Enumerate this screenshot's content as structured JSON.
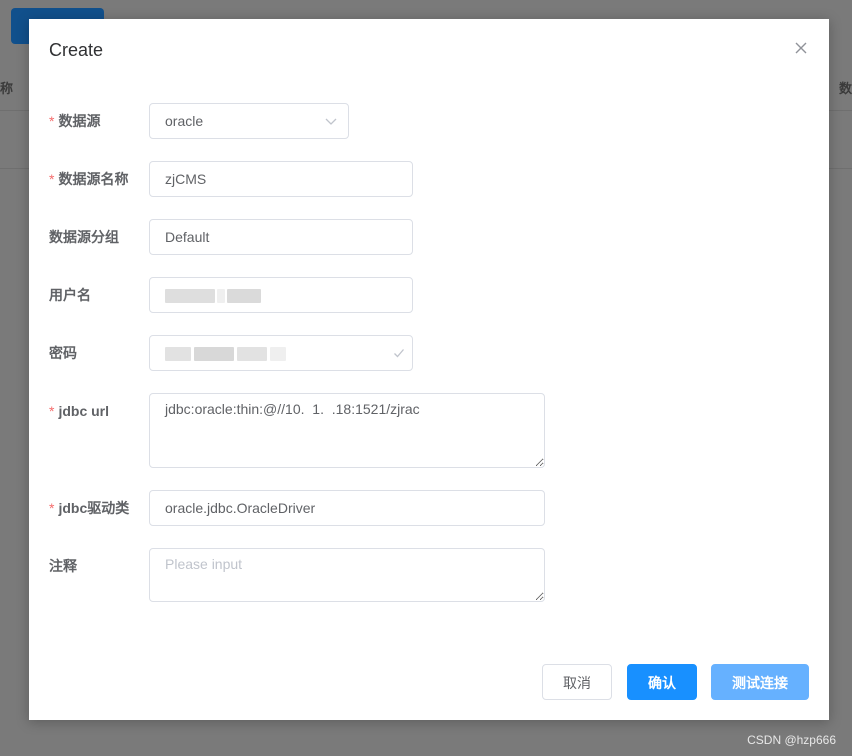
{
  "background": {
    "header_left_fragment": "称",
    "header_right_fragment": "数"
  },
  "dialog": {
    "title": "Create",
    "close_icon": "close-icon"
  },
  "form": {
    "datasource": {
      "label": "数据源",
      "required": true,
      "value": "oracle",
      "icon": "chevron-down-icon"
    },
    "datasource_name": {
      "label": "数据源名称",
      "required": true,
      "value": "zjCMS"
    },
    "datasource_group": {
      "label": "数据源分组",
      "required": false,
      "value": "Default"
    },
    "username": {
      "label": "用户名",
      "required": false,
      "value": ""
    },
    "password": {
      "label": "密码",
      "required": false,
      "value": "",
      "icon": "check-icon"
    },
    "jdbc_url": {
      "label": "jdbc url",
      "required": true,
      "value": "jdbc:oracle:thin:@//10.  1.  .18:1521/zjrac"
    },
    "jdbc_driver": {
      "label": "jdbc驱动类",
      "required": true,
      "value": "oracle.jdbc.OracleDriver"
    },
    "comment": {
      "label": "注释",
      "required": false,
      "placeholder": "Please input",
      "value": ""
    }
  },
  "footer": {
    "cancel_label": "取消",
    "confirm_label": "确认",
    "test_label": "测试连接"
  },
  "watermark": "CSDN @hzp666",
  "colors": {
    "primary": "#1890ff",
    "primary_light": "#66b1ff",
    "required": "#f56c6c"
  }
}
